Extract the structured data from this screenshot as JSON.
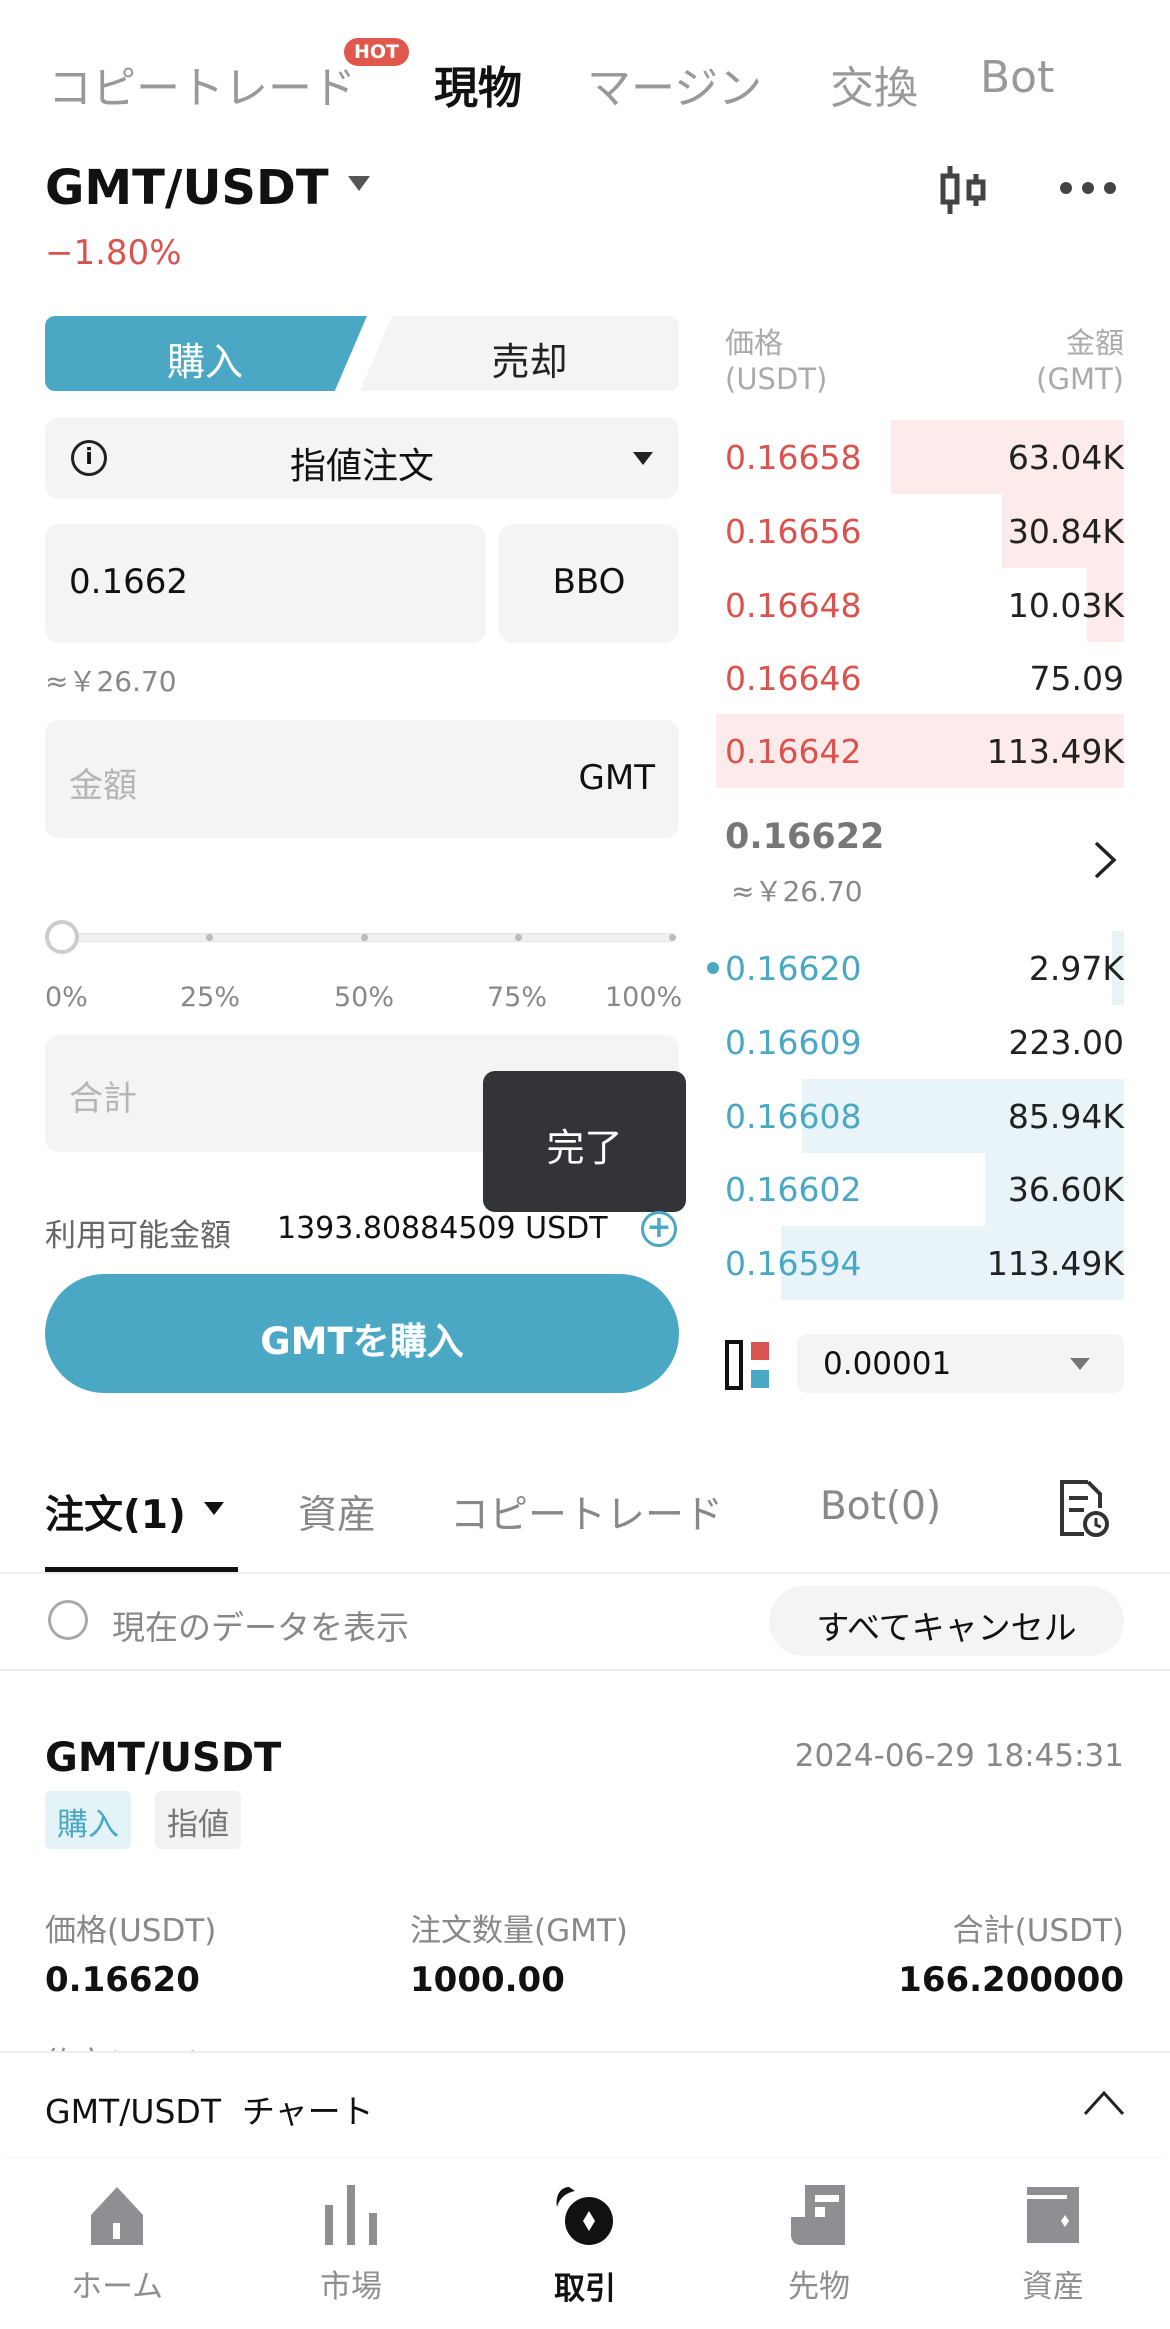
{
  "top_tabs": [
    {
      "label": "コピートレード",
      "badge": "HOT"
    },
    {
      "label": "現物",
      "active": true
    },
    {
      "label": "マージン"
    },
    {
      "label": "交換"
    },
    {
      "label": "Bot"
    }
  ],
  "pair": {
    "symbol": "GMT/USDT",
    "change": "−1.80%"
  },
  "colors": {
    "accent": "#4aa8c4",
    "sell": "#d9534f",
    "buy": "#4aa8c4"
  },
  "form": {
    "buy_tab": "購入",
    "sell_tab": "売却",
    "order_type": "指値注文",
    "price_value": "0.1662",
    "bbo_label": "BBO",
    "price_fiat": "≈￥26.70",
    "amount_placeholder": "金額",
    "amount_unit": "GMT",
    "slider_value": 0,
    "slider_labels": [
      "0%",
      "25%",
      "50%",
      "75%",
      "100%"
    ],
    "total_placeholder": "合計",
    "done_tooltip": "完了",
    "available_label": "利用可能金額",
    "available_value": "1393.80884509 USDT",
    "buy_button": "GMTを購入"
  },
  "orderbook": {
    "price_header": "価格",
    "price_unit": "(USDT)",
    "amount_header": "金額",
    "amount_unit": "(GMT)",
    "asks": [
      {
        "price": "0.16658",
        "qty": "63.04K",
        "depth": 0.57
      },
      {
        "price": "0.16656",
        "qty": "30.84K",
        "depth": 0.3
      },
      {
        "price": "0.16648",
        "qty": "10.03K",
        "depth": 0.09
      },
      {
        "price": "0.16646",
        "qty": "75.09",
        "depth": 0
      },
      {
        "price": "0.16642",
        "qty": "113.49K",
        "depth": 1.0
      }
    ],
    "mid_price": "0.16622",
    "mid_fiat": "≈￥26.70",
    "bids": [
      {
        "price": "0.16620",
        "qty": "2.97K",
        "depth": 0.03
      },
      {
        "price": "0.16609",
        "qty": "223.00",
        "depth": 0
      },
      {
        "price": "0.16608",
        "qty": "85.94K",
        "depth": 0.79
      },
      {
        "price": "0.16602",
        "qty": "36.60K",
        "depth": 0.34
      },
      {
        "price": "0.16594",
        "qty": "113.49K",
        "depth": 0.84
      }
    ],
    "precision": "0.00001"
  },
  "bottom_tabs": [
    {
      "label": "注文(1)",
      "active": true
    },
    {
      "label": "資産"
    },
    {
      "label": "コピートレード"
    },
    {
      "label": "Bot(0)"
    }
  ],
  "filter": {
    "show_current": "現在のデータを表示",
    "cancel_all": "すべてキャンセル"
  },
  "order": {
    "symbol": "GMT/USDT",
    "time": "2024-06-29 18:45:31",
    "side_tag": "購入",
    "type_tag": "指値",
    "price_label": "価格(USDT)",
    "price": "0.16620",
    "qty_label": "注文数量(GMT)",
    "qty": "1000.00",
    "total_label": "合計(USDT)",
    "total": "166.200000",
    "filled_label": "約定(GMT)"
  },
  "chart_bar": {
    "label": "GMT/USDT  チャート"
  },
  "nav": [
    {
      "label": "ホーム",
      "icon": "home-icon"
    },
    {
      "label": "市場",
      "icon": "market-icon"
    },
    {
      "label": "取引",
      "icon": "trade-icon",
      "active": true
    },
    {
      "label": "先物",
      "icon": "futures-icon"
    },
    {
      "label": "資産",
      "icon": "wallet-icon"
    }
  ]
}
